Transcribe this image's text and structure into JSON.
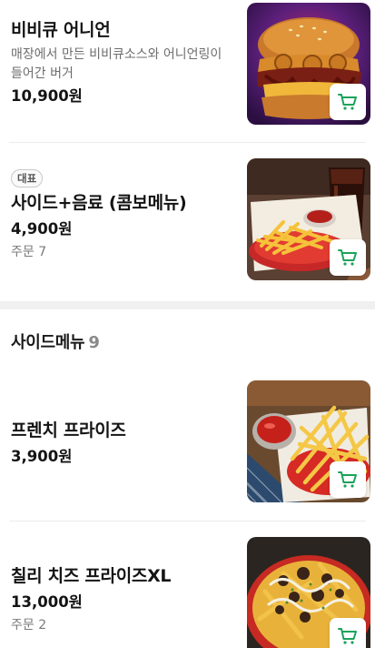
{
  "items": [
    {
      "name": "비비큐 어니언",
      "description": "매장에서 만든 비비큐소스와 어니언링이 들어간 버거",
      "price": "10,900원",
      "image": "burger-photo",
      "cart_icon": "cart-icon"
    },
    {
      "badge": "대표",
      "name": "사이드+음료 (콤보메뉴)",
      "price": "4,900원",
      "orders": "주문 7",
      "image": "fries-and-cola-photo",
      "cart_icon": "cart-icon"
    }
  ],
  "side_section": {
    "title": "사이드메뉴",
    "count": "9",
    "items": [
      {
        "name": "프렌치 프라이즈",
        "price": "3,900원",
        "image": "french-fries-photo",
        "cart_icon": "cart-icon"
      },
      {
        "name": "칠리 치즈 프라이즈XL",
        "price": "13,000원",
        "orders": "주문 2",
        "image": "chili-cheese-fries-photo",
        "cart_icon": "cart-icon"
      }
    ]
  },
  "colors": {
    "accent": "#1aa35b",
    "divider": "#ececec",
    "section_gap": "#f0f0f0"
  }
}
